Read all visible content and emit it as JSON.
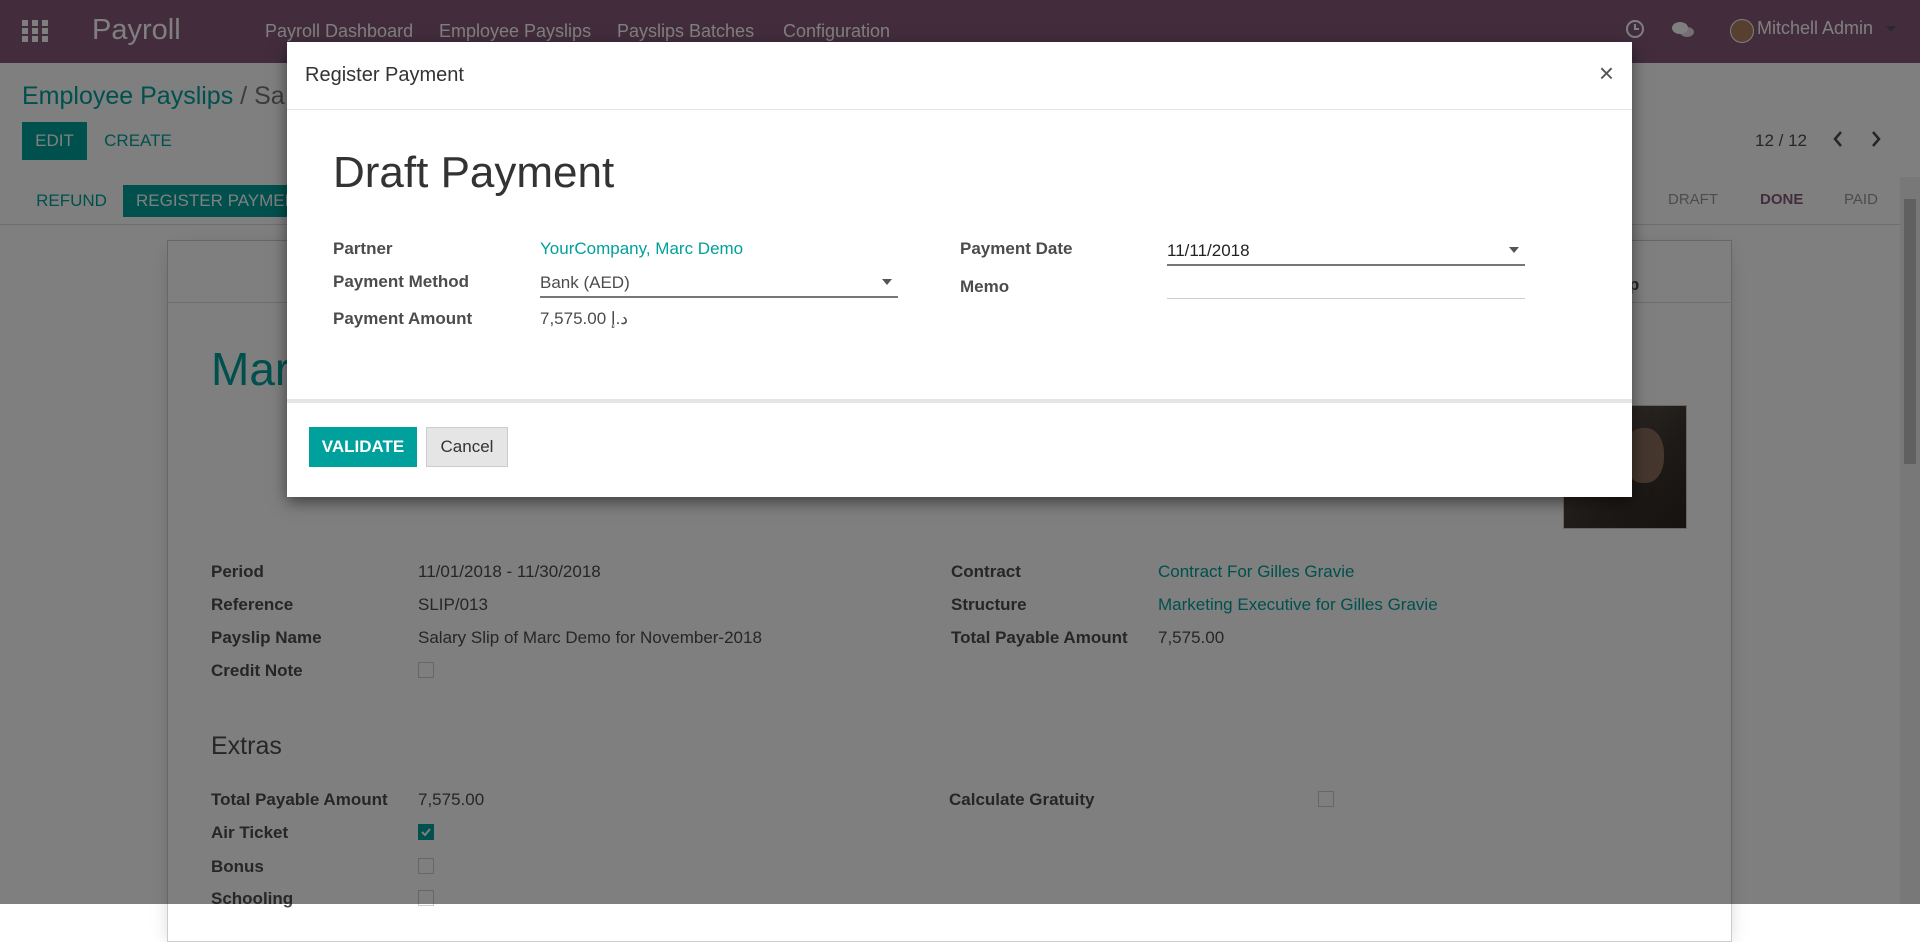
{
  "navbar": {
    "brand": "Payroll",
    "menu": [
      "Payroll Dashboard",
      "Employee Payslips",
      "Payslips Batches",
      "Configuration"
    ],
    "user": "Mitchell Admin"
  },
  "control_panel": {
    "breadcrumb_parent": "Employee Payslips",
    "breadcrumb_sep": "/",
    "breadcrumb_current": "Sa",
    "edit_label": "EDIT",
    "create_label": "CREATE",
    "pager": "12 / 12"
  },
  "statusbar": {
    "refund_label": "REFUND",
    "register_payment_label": "REGISTER PAYMENT",
    "stages": [
      "DRAFT",
      "DONE",
      "PAID"
    ],
    "active_stage": "DONE"
  },
  "sheet": {
    "smart_button_label": "slip",
    "employee_name": "Mar",
    "left_fields": [
      {
        "label": "Period",
        "value": "11/01/2018 - 11/30/2018"
      },
      {
        "label": "Reference",
        "value": "SLIP/013"
      },
      {
        "label": "Payslip Name",
        "value": "Salary Slip of Marc Demo for November-2018"
      },
      {
        "label": "Credit Note",
        "value": ""
      }
    ],
    "right_fields": [
      {
        "label": "Contract",
        "value": "Contract For Gilles Gravie"
      },
      {
        "label": "Structure",
        "value": "Marketing Executive for Gilles Gravie"
      },
      {
        "label": "Total Payable Amount",
        "value": "7,575.00"
      }
    ],
    "extras_title": "Extras",
    "extras_left": [
      {
        "label": "Total Payable Amount",
        "value": "7,575.00"
      },
      {
        "label": "Air Ticket",
        "value": ""
      },
      {
        "label": "Bonus",
        "value": ""
      },
      {
        "label": "Schooling",
        "value": ""
      }
    ],
    "extras_right": [
      {
        "label": "Calculate Gratuity",
        "value": ""
      }
    ],
    "air_ticket_checked": true
  },
  "modal": {
    "title": "Register Payment",
    "close": "×",
    "heading": "Draft Payment",
    "partner_label": "Partner",
    "partner_value": "YourCompany, Marc Demo",
    "method_label": "Payment Method",
    "method_value": "Bank (AED)",
    "amount_label": "Payment Amount",
    "amount_value": "7,575.00 د.إ",
    "date_label": "Payment Date",
    "date_value": "11/11/2018",
    "memo_label": "Memo",
    "memo_value": "",
    "validate_label": "VALIDATE",
    "cancel_label": "Cancel"
  }
}
